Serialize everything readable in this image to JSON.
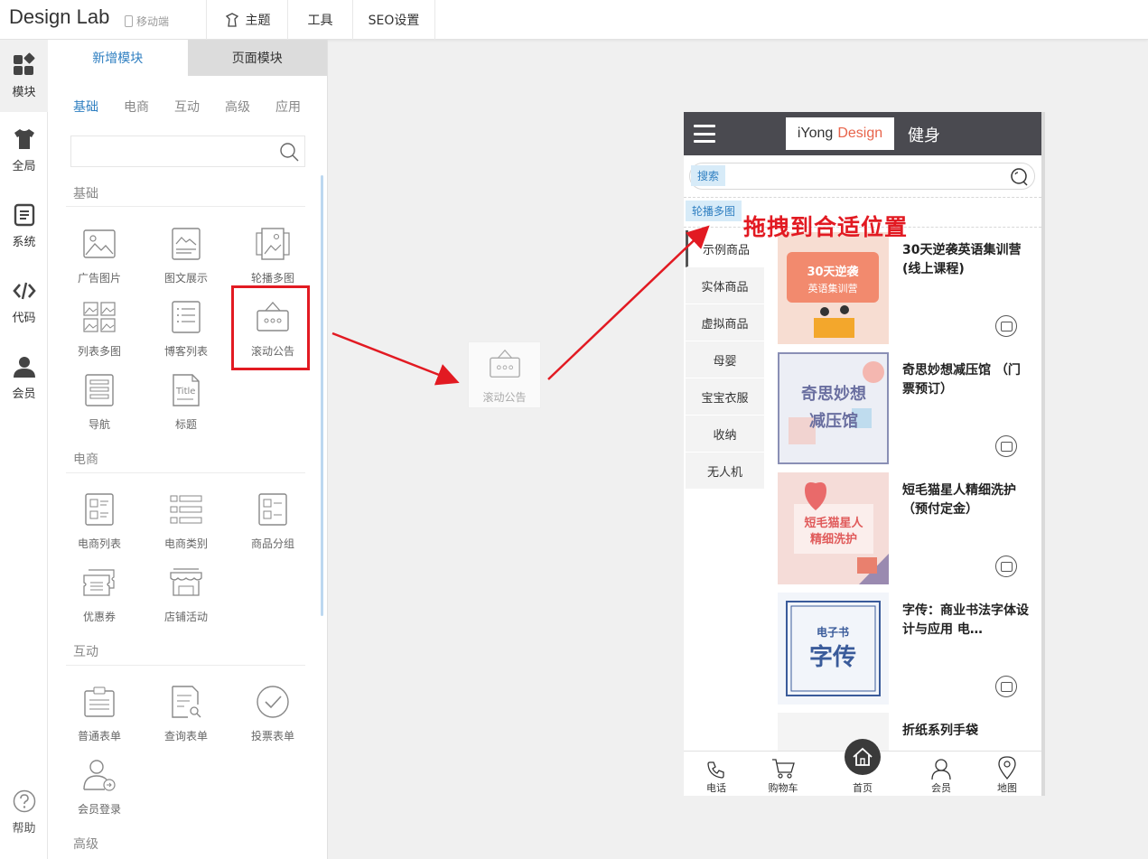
{
  "app": {
    "brand": "Design Lab",
    "mobile_mode": "移动端"
  },
  "topnav": {
    "theme": "主题",
    "tools": "工具",
    "seo": "SEO设置"
  },
  "rail": {
    "modules": "模块",
    "global": "全局",
    "system": "系统",
    "code": "代码",
    "member": "会员",
    "help": "帮助"
  },
  "panel": {
    "tab_add": "新增模块",
    "tab_page": "页面模块",
    "categories": [
      "基础",
      "电商",
      "互动",
      "高级",
      "应用"
    ],
    "search_placeholder": "",
    "sections": {
      "basic": "基础",
      "ecommerce": "电商",
      "interactive": "互动",
      "advanced": "高级"
    },
    "basic_modules": [
      "广告图片",
      "图文展示",
      "轮播多图",
      "列表多图",
      "博客列表",
      "滚动公告",
      "导航",
      "标题"
    ],
    "ecommerce_modules": [
      "电商列表",
      "电商类别",
      "商品分组",
      "优惠券",
      "店铺活动"
    ],
    "interactive_modules": [
      "普通表单",
      "查询表单",
      "投票表单",
      "会员登录"
    ]
  },
  "ghost": {
    "label": "滚动公告"
  },
  "phone": {
    "logo_part1": "iYong",
    "logo_part2": "Design",
    "site_name": "健身",
    "search_tag": "搜索",
    "carousel_tag": "轮播多图",
    "drop_hint": "拖拽到合适位置",
    "side_categories": [
      "示例商品",
      "实体商品",
      "虚拟商品",
      "母婴",
      "宝宝衣服",
      "收纳",
      "无人机"
    ],
    "products": [
      {
        "title": "30天逆袭英语集训营 (线上课程)",
        "thumb_text": "30天逆袭英语集训营"
      },
      {
        "title": "奇思妙想减压馆 （门票预订）",
        "thumb_text": "奇思妙想减压馆"
      },
      {
        "title": "短毛猫星人精细洗护 （预付定金）",
        "thumb_text": "短毛猫星人精细洗护"
      },
      {
        "title": "字传：商业书法字体设计与应用 电…",
        "thumb_text_small": "电子书",
        "thumb_text": "字传"
      },
      {
        "title": "折纸系列手袋"
      }
    ],
    "bottom_nav": [
      "电话",
      "购物车",
      "首页",
      "会员",
      "地图"
    ]
  },
  "colors": {
    "accent": "#2f7fc1",
    "highlight": "#e21a22",
    "header": "#4a4a50"
  }
}
